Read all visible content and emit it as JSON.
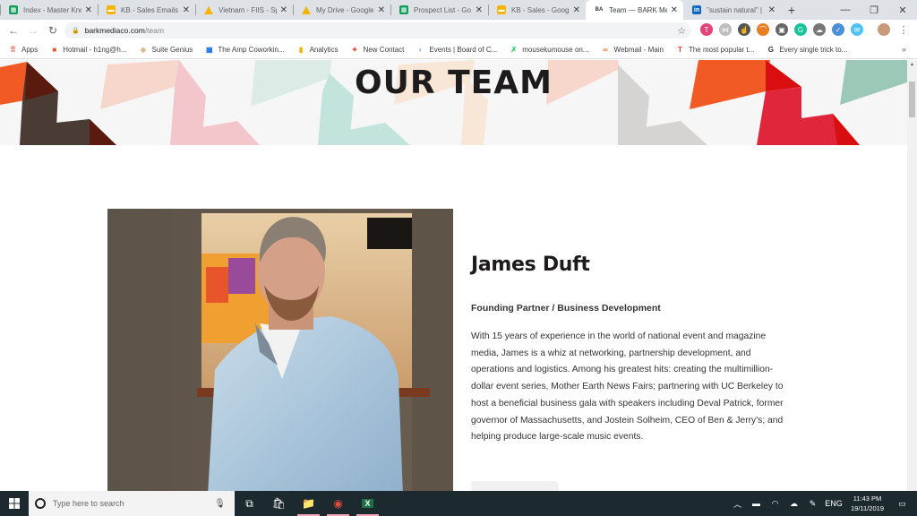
{
  "browser": {
    "tabs": [
      {
        "favicon": "sheets-icon",
        "title": "Index - Master Kno",
        "active": false
      },
      {
        "favicon": "slides-icon",
        "title": "KB - Sales Emails -",
        "active": false
      },
      {
        "favicon": "drive-icon",
        "title": "Vietnam - FIIS - Sp",
        "active": false
      },
      {
        "favicon": "drive-icon",
        "title": "My Drive - Google",
        "active": false
      },
      {
        "favicon": "sheets-icon",
        "title": "Prospect List - Go",
        "active": false
      },
      {
        "favicon": "slides-icon",
        "title": "KB - Sales - Google",
        "active": false
      },
      {
        "favicon": "bark-icon",
        "title": "Team — BARK Me",
        "active": true
      },
      {
        "favicon": "linkedin-icon",
        "title": "\"sustain natural\" |",
        "active": false
      }
    ],
    "close_glyph": "✕",
    "new_tab_glyph": "+",
    "window_controls": {
      "minimize": "—",
      "maximize": "❐",
      "close": "✕"
    },
    "url": {
      "domain": "barkmediaco.com",
      "path": "/team"
    },
    "extensions": [
      {
        "name": "toggl-icon",
        "glyph": "T",
        "color": "#e0457b"
      },
      {
        "name": "link-icon",
        "glyph": "⋈",
        "color": "#bdbdbd"
      },
      {
        "name": "hand-icon",
        "glyph": "☝",
        "color": "#555555"
      },
      {
        "name": "rainbow-icon",
        "glyph": "⌒",
        "color": "#e67e22"
      },
      {
        "name": "scan-icon",
        "glyph": "▣",
        "color": "#666666"
      },
      {
        "name": "grammarly-icon",
        "glyph": "G",
        "color": "#15c39a"
      },
      {
        "name": "cloud-icon",
        "glyph": "☁",
        "color": "#777777"
      },
      {
        "name": "shield-icon",
        "glyph": "✓",
        "color": "#4a90d9"
      },
      {
        "name": "mail-icon",
        "glyph": "✉",
        "color": "#4fc3f7"
      }
    ],
    "bookmarks": [
      {
        "icon": "apps-icon",
        "label": "Apps",
        "color": "#e8453c"
      },
      {
        "icon": "microsoft-icon",
        "label": "Hotmail - h1ng@h...",
        "color": "#f25022"
      },
      {
        "icon": "diamond-icon",
        "label": "Suite Genius",
        "color": "#d7b98e"
      },
      {
        "icon": "table-icon",
        "label": "The Amp Coworkin...",
        "color": "#1a73e8"
      },
      {
        "icon": "analytics-icon",
        "label": "Analytics",
        "color": "#f9ab00"
      },
      {
        "icon": "contact-icon",
        "label": "New Contact",
        "color": "#ea4335"
      },
      {
        "icon": "events-icon",
        "label": "Events | Board of C...",
        "color": "#8ab4f8"
      },
      {
        "icon": "mouse-icon",
        "label": "mousekumouse on...",
        "color": "#1ed760"
      },
      {
        "icon": "webmail-icon",
        "label": "Webmail - Main",
        "color": "#ff6c2c"
      },
      {
        "icon": "t-icon",
        "label": "The most popular t...",
        "color": "#e53935"
      },
      {
        "icon": "g-icon",
        "label": "Every single trick to...",
        "color": "#333333"
      }
    ],
    "bookmarks_overflow": "»"
  },
  "page": {
    "hero_title": "OUR TEAM",
    "member": {
      "name": "James Duft",
      "role": "Founding Partner / Business Development",
      "bio": "With 15 years of experience in the world of national event and magazine media, James is a whiz at networking, partnership development, and operations and logistics. Among his greatest hits: creating the multimillion-dollar event series, Mother Earth News Fairs; partnering with UC Berkeley to host a beneficial business gala with speakers including Deval Patrick, former governor of Massachusetts, and Jostein Solheim, CEO of Ben & Jerry's; and helping produce large-scale music events."
    },
    "hero_colors": [
      "#f15a24",
      "#4a3b35",
      "#5a1a0e",
      "#f7d6cc",
      "#f3c6cc",
      "#dcebe6",
      "#c3e4dc",
      "#f8e6d6",
      "#d6d3d3",
      "#e0263a",
      "#d90f0f",
      "#9cc8b8"
    ]
  },
  "taskbar": {
    "search_placeholder": "Type here to search",
    "pinned": [
      {
        "name": "task-view-icon",
        "glyph": "⧉",
        "running": false
      },
      {
        "name": "store-icon",
        "glyph": "🛍",
        "running": false
      },
      {
        "name": "file-explorer-icon",
        "glyph": "📁",
        "running": true
      },
      {
        "name": "chrome-icon",
        "glyph": "◉",
        "running": true
      },
      {
        "name": "excel-icon",
        "glyph": "X",
        "running": true
      }
    ],
    "tray": {
      "icons": [
        "chevron-up-icon",
        "battery-icon",
        "wifi-icon",
        "onedrive-icon",
        "pen-icon"
      ],
      "language": "ENG",
      "time": "11:43 PM",
      "date": "19/11/2019"
    }
  }
}
